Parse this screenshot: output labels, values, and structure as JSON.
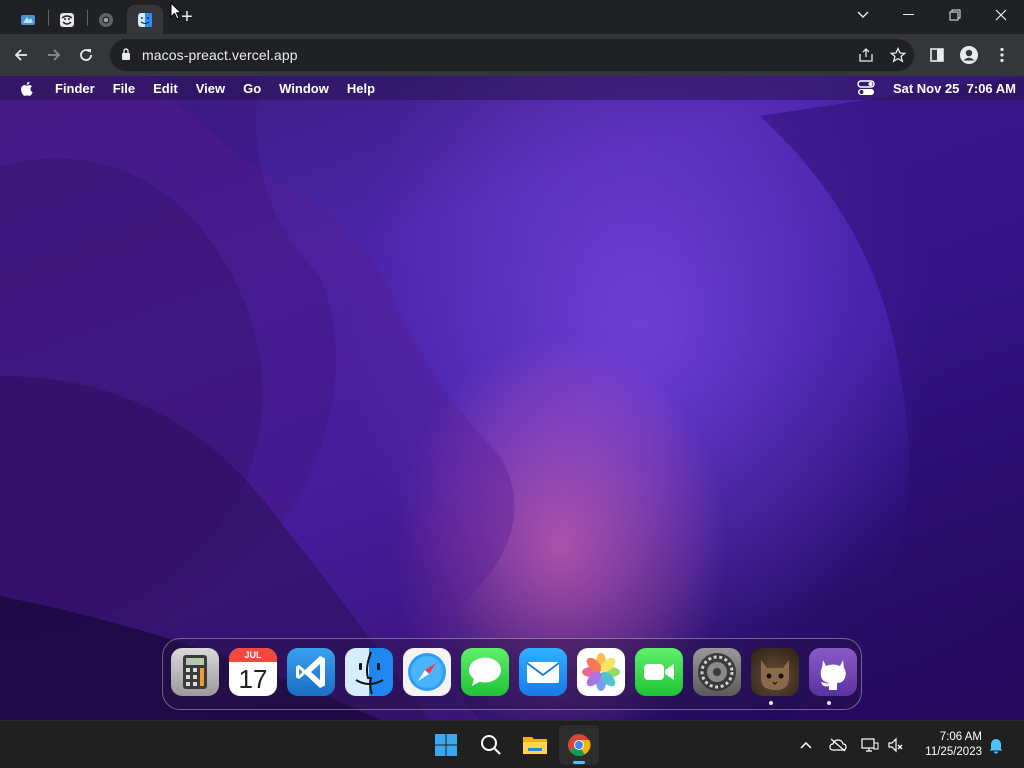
{
  "browser": {
    "tabs": [
      {
        "name": "tab-1",
        "icon": "windows-app-icon"
      },
      {
        "name": "tab-2",
        "icon": "trollface-icon"
      },
      {
        "name": "tab-3",
        "icon": "chromium-icon"
      },
      {
        "name": "tab-4",
        "icon": "finder-icon",
        "active": true
      }
    ],
    "new_tab_label": "+",
    "url": "macos-preact.vercel.app"
  },
  "macos": {
    "menu": [
      "Finder",
      "File",
      "Edit",
      "View",
      "Go",
      "Window",
      "Help"
    ],
    "datetime": "Sat Nov 25  7:06 AM",
    "dock": {
      "items": [
        {
          "name": "calculator",
          "running": false
        },
        {
          "name": "calendar",
          "running": false
        },
        {
          "name": "vscode",
          "running": false
        },
        {
          "name": "finder",
          "running": false
        },
        {
          "name": "safari",
          "running": false
        },
        {
          "name": "messages",
          "running": false
        },
        {
          "name": "mail",
          "running": false
        },
        {
          "name": "photos",
          "running": false
        },
        {
          "name": "facetime",
          "running": false
        },
        {
          "name": "system-preferences",
          "running": false
        },
        {
          "name": "cat-app",
          "running": true
        },
        {
          "name": "github",
          "running": true
        }
      ],
      "calendar_month": "JUL",
      "calendar_day": "17"
    }
  },
  "taskbar": {
    "time": "7:06 AM",
    "date": "11/25/2023",
    "accent": "#4cc2ff"
  }
}
